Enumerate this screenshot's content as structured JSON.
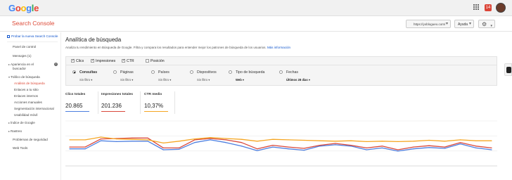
{
  "topbar": {
    "logo_letters": [
      {
        "ch": "G",
        "color": "#4285f4"
      },
      {
        "ch": "o",
        "color": "#ea4335"
      },
      {
        "ch": "o",
        "color": "#fbbc05"
      },
      {
        "ch": "g",
        "color": "#4285f4"
      },
      {
        "ch": "l",
        "color": "#34a853"
      },
      {
        "ch": "e",
        "color": "#ea4335"
      }
    ],
    "notification_count": "14"
  },
  "subbar": {
    "brand": "Search Console",
    "site": "https://yoblogueo.com/",
    "help_label": "Ayuda",
    "settings_icon": "gear-icon"
  },
  "sidebar": {
    "new_console_link": "Probar la nueva Search Console",
    "panel": "Panel de control",
    "messages": "Mensajes (1)",
    "search_appearance_line1": "Apariencia en el",
    "search_appearance_line2": "buscador",
    "search_traffic": "Tráfico de búsqueda",
    "traffic_items": [
      "Análisis de búsqueda",
      "Enlaces a tu sitio",
      "Enlaces internos",
      "Acciones manuales",
      "Segmentación internacional",
      "Usabilidad móvil"
    ],
    "google_index": "Índice de Google",
    "crawl": "Rastreo",
    "security": "Problemas de seguridad",
    "web_tools": "Web Tools"
  },
  "main": {
    "title": "Analítica de búsqueda",
    "description": "Analiza tu rendimiento en Búsqueda de Google. Filtra y compara los resultados para entender mejor los patrones de búsqueda de los usuarios.",
    "more_info": "Más información",
    "checks": [
      {
        "label": "Clics",
        "checked": true
      },
      {
        "label": "Impresiones",
        "checked": true
      },
      {
        "label": "CTR",
        "checked": true
      },
      {
        "label": "Posición",
        "checked": false
      }
    ],
    "dimensions": [
      {
        "label": "Consultas",
        "sub": "Sin filtro",
        "selected": true
      },
      {
        "label": "Páginas",
        "sub": "Sin filtro",
        "selected": false
      },
      {
        "label": "Países",
        "sub": "Sin filtro",
        "selected": false
      },
      {
        "label": "Dispositivos",
        "sub": "Sin filtro",
        "selected": false
      },
      {
        "label": "Tipo de búsqueda",
        "sub": "Web",
        "selected": false
      },
      {
        "label": "Fechas",
        "sub": "Últimos 28 días",
        "selected": false
      }
    ],
    "metrics": [
      {
        "label": "Clics totales",
        "value": "20.865",
        "color": "#4d7fe0"
      },
      {
        "label": "Impresiones totales",
        "value": "201.236",
        "color": "#d9483b"
      },
      {
        "label": "CTR medio",
        "value": "10,37%",
        "color": "#f5a623"
      }
    ]
  },
  "chart_data": {
    "type": "line",
    "x": [
      1,
      2,
      3,
      4,
      5,
      6,
      7,
      8,
      9,
      10,
      11,
      12,
      13,
      14,
      15,
      16,
      17,
      18,
      19,
      20,
      21,
      22,
      23,
      24,
      25,
      26,
      27,
      28
    ],
    "series": [
      {
        "name": "Clics totales",
        "color": "#4d7fe0",
        "values": [
          38,
          38,
          56,
          54,
          55,
          55,
          36,
          37,
          52,
          58,
          52,
          44,
          34,
          42,
          38,
          35,
          44,
          47,
          44,
          36,
          40,
          33,
          38,
          41,
          39,
          49,
          40,
          36
        ]
      },
      {
        "name": "Impresiones totales",
        "color": "#d9483b",
        "values": [
          42,
          42,
          60,
          61,
          62,
          62,
          40,
          40,
          58,
          61,
          58,
          52,
          38,
          46,
          42,
          39,
          46,
          50,
          46,
          40,
          44,
          36,
          42,
          45,
          42,
          52,
          44,
          40
        ]
      },
      {
        "name": "CTR medio",
        "color": "#f5a623",
        "values": [
          58,
          58,
          64,
          60,
          59,
          58,
          51,
          55,
          60,
          63,
          61,
          59,
          55,
          59,
          58,
          57,
          56,
          55,
          56,
          54,
          55,
          54,
          55,
          57,
          55,
          58,
          56,
          56
        ]
      }
    ],
    "ylim": [
      0,
      100
    ],
    "grid": true
  }
}
